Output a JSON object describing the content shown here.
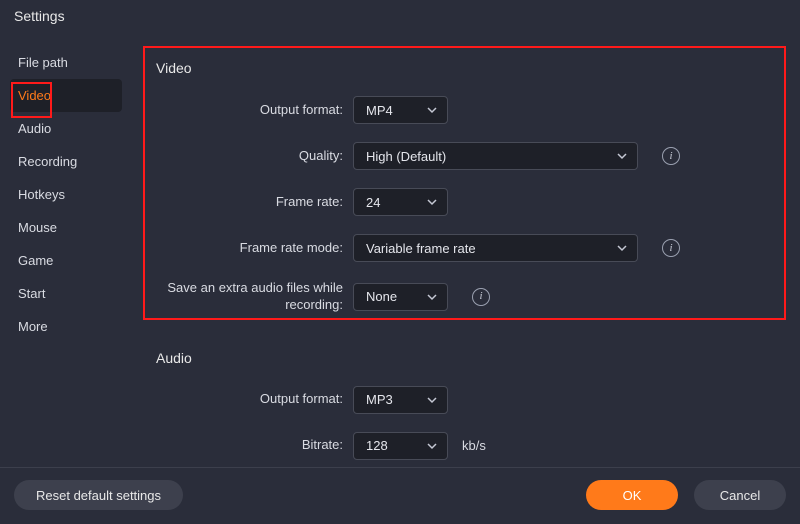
{
  "title": "Settings",
  "sidebar": {
    "items": [
      {
        "label": "File path"
      },
      {
        "label": "Video"
      },
      {
        "label": "Audio"
      },
      {
        "label": "Recording"
      },
      {
        "label": "Hotkeys"
      },
      {
        "label": "Mouse"
      },
      {
        "label": "Game"
      },
      {
        "label": "Start"
      },
      {
        "label": "More"
      }
    ]
  },
  "video": {
    "section_title": "Video",
    "output_format": {
      "label": "Output format:",
      "value": "MP4"
    },
    "quality": {
      "label": "Quality:",
      "value": "High (Default)"
    },
    "frame_rate": {
      "label": "Frame rate:",
      "value": "24"
    },
    "frame_rate_mode": {
      "label": "Frame rate mode:",
      "value": "Variable frame rate"
    },
    "save_extra_audio": {
      "label": "Save an extra audio files while recording:",
      "value": "None"
    }
  },
  "audio": {
    "section_title": "Audio",
    "output_format": {
      "label": "Output format:",
      "value": "MP3"
    },
    "bitrate": {
      "label": "Bitrate:",
      "value": "128",
      "unit": "kb/s"
    }
  },
  "footer": {
    "reset": "Reset default settings",
    "ok": "OK",
    "cancel": "Cancel"
  }
}
